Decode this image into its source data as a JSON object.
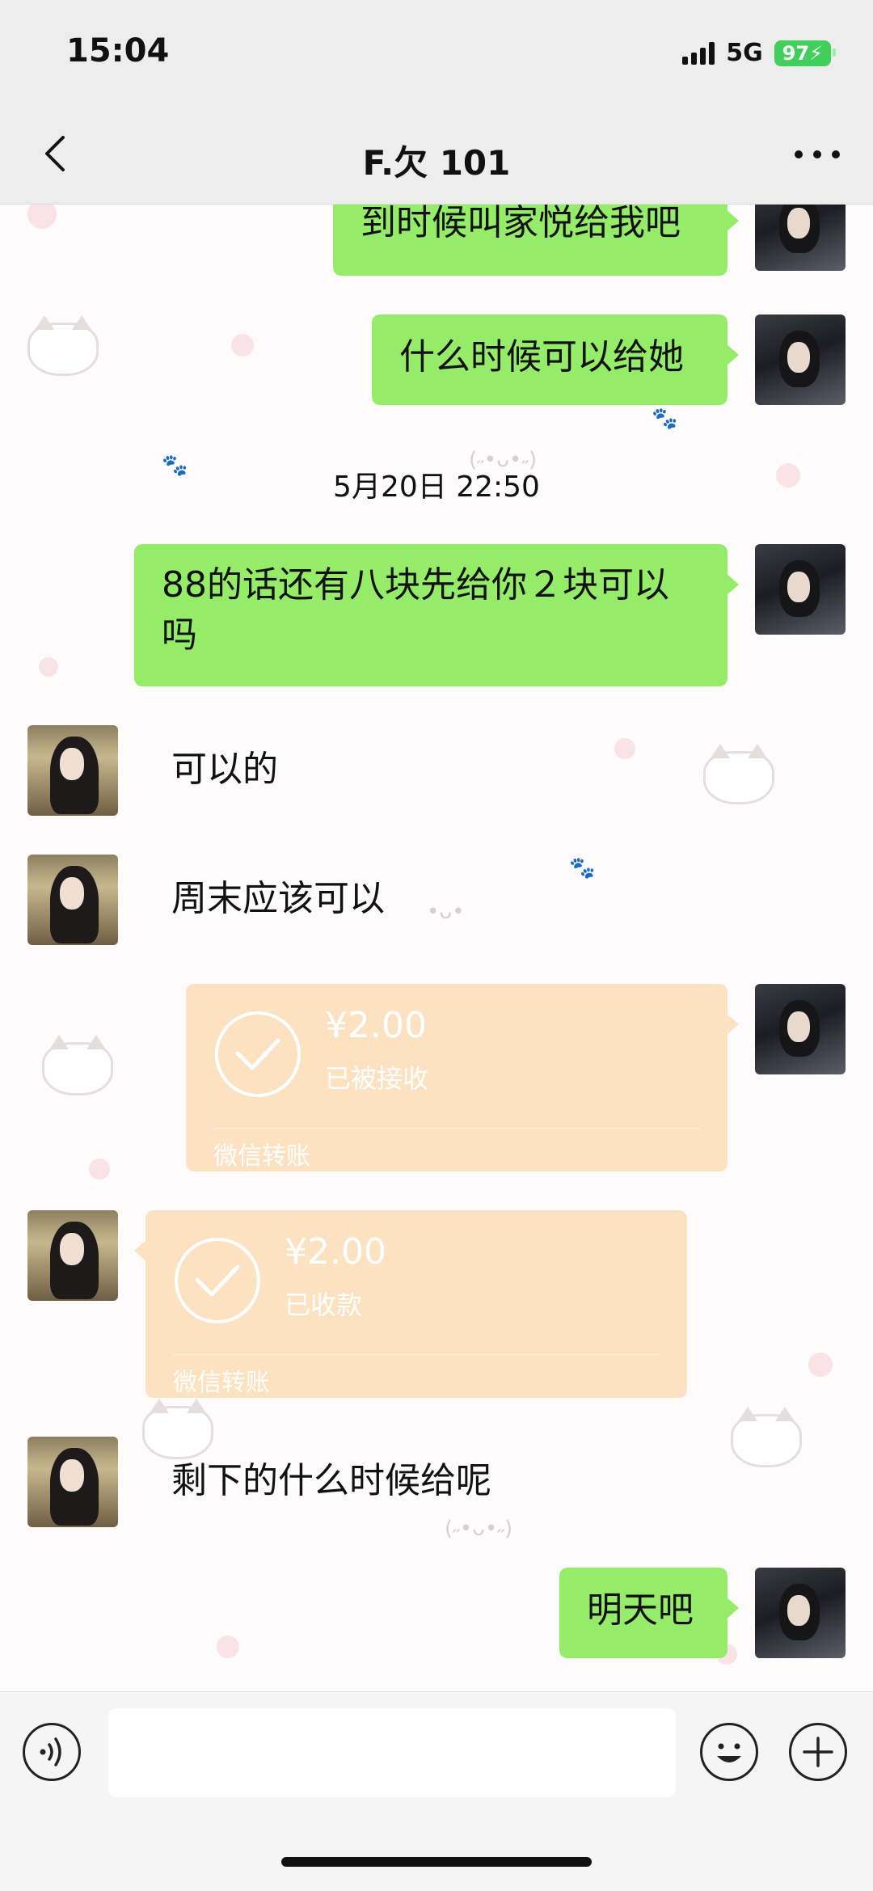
{
  "status_bar": {
    "time": "15:04",
    "network": "5G",
    "battery": "97"
  },
  "nav": {
    "title": "F.欠 101"
  },
  "messages": [
    {
      "text": "到时候叫家悦给我吧"
    },
    {
      "text": "什么时候可以给她"
    },
    {
      "timestamp": "5月20日 22:50"
    },
    {
      "text": "88的话还有八块先给你２块可以吗"
    },
    {
      "text": "可以的"
    },
    {
      "text": "周末应该可以"
    },
    {
      "amount": "¥2.00",
      "status": "已被接收",
      "label": "微信转账"
    },
    {
      "amount": "¥2.00",
      "status": "已收款",
      "label": "微信转账"
    },
    {
      "text": "剩下的什么时候给呢"
    },
    {
      "text": "明天吧"
    }
  ],
  "colors": {
    "my_bubble": "#95ec69",
    "transfer": "#fde2c2",
    "nav_bg": "#ededed"
  }
}
